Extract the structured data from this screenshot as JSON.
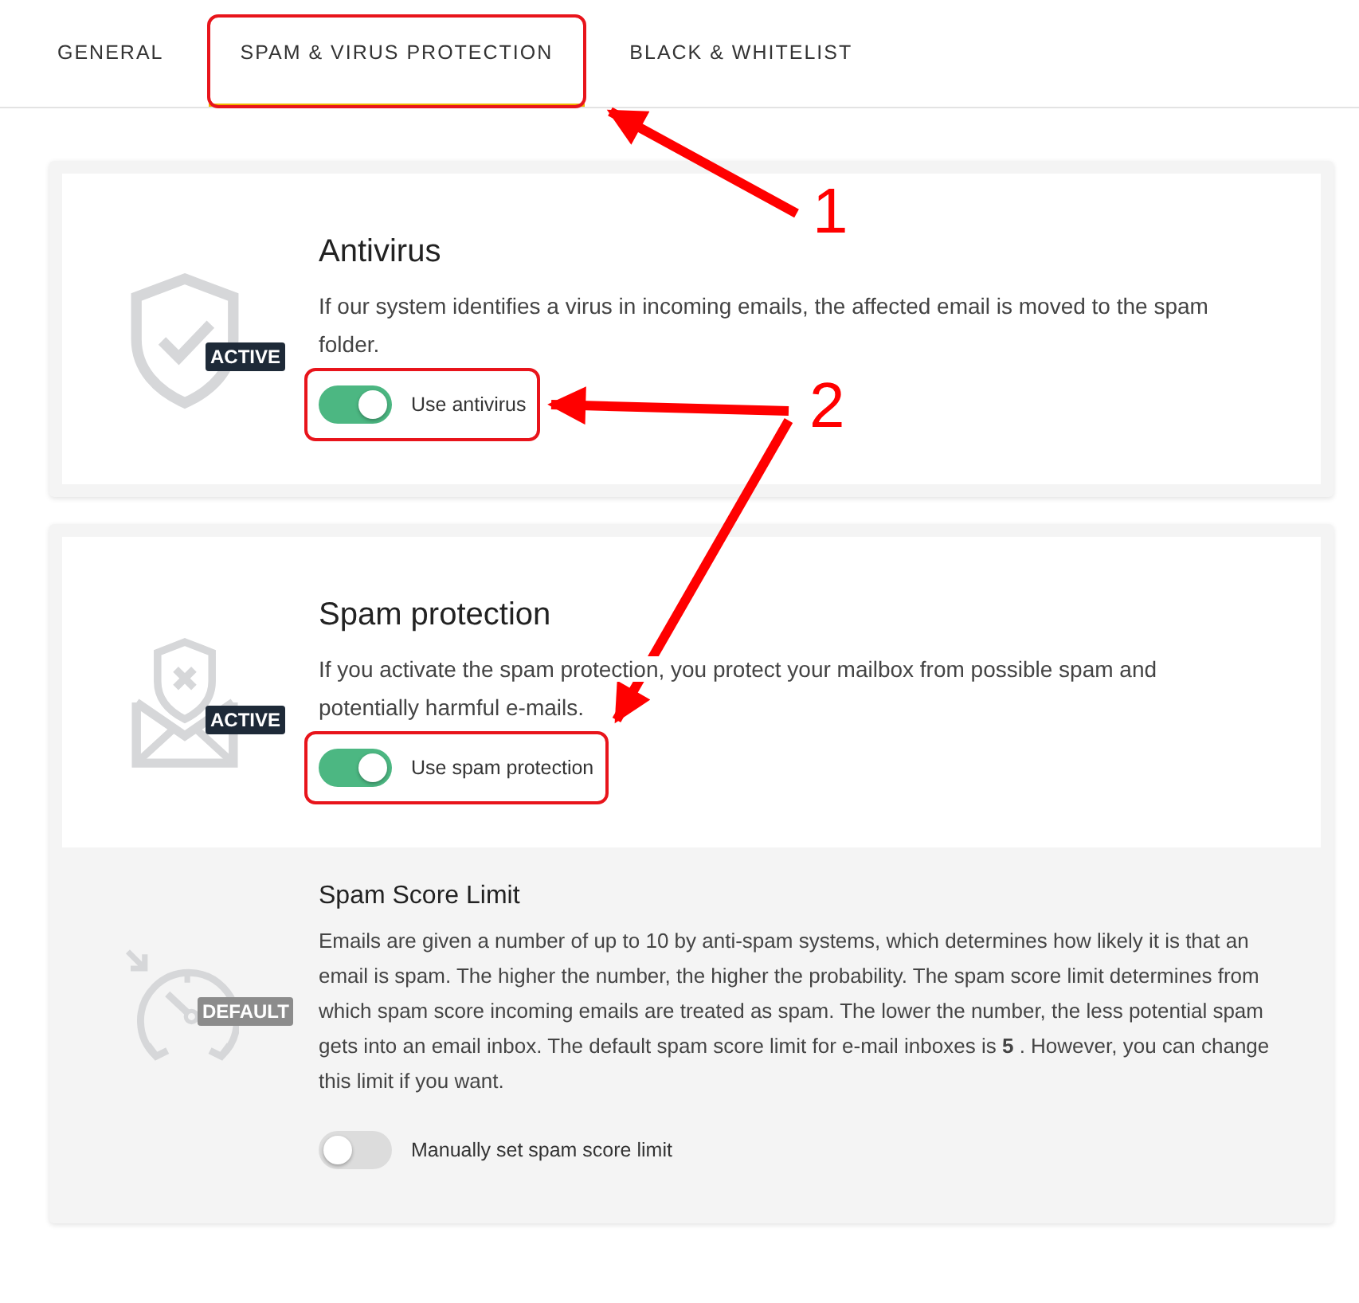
{
  "tabs": [
    {
      "label": "GENERAL",
      "selected": false
    },
    {
      "label": "SPAM & VIRUS PROTECTION",
      "selected": true
    },
    {
      "label": "BLACK & WHITELIST",
      "selected": false
    }
  ],
  "cards": [
    {
      "panels": [
        {
          "kind": "feature",
          "badge": {
            "text": "ACTIVE",
            "kind": "active"
          },
          "title": "Antivirus",
          "description": "If our system identifies a virus in incoming emails, the affected email is moved to the spam folder.",
          "toggle": {
            "label": "Use antivirus",
            "on": true
          }
        }
      ]
    },
    {
      "panels": [
        {
          "kind": "feature",
          "badge": {
            "text": "ACTIVE",
            "kind": "active"
          },
          "title": "Spam protection",
          "description": "If you activate the spam protection, you protect your mailbox from possible spam and potentially harmful e-mails.",
          "toggle": {
            "label": "Use spam protection",
            "on": true
          }
        },
        {
          "kind": "setting",
          "badge": {
            "text": "DEFAULT",
            "kind": "default"
          },
          "title": "Spam Score Limit",
          "description": "Emails are given a number of up to 10 by anti-spam systems, which determines how likely it is that an email is spam. The higher the number, the higher the probability. The spam score limit determines from which spam score incoming emails are treated as spam. The lower the number, the less potential spam gets into an email inbox. The default spam score limit for e-mail inboxes is **5** . However, you can change this limit if you want.",
          "toggle": {
            "label": "Manually set spam score limit",
            "on": false
          }
        }
      ]
    }
  ],
  "annotations": [
    {
      "label": "1"
    },
    {
      "label": "2"
    }
  ]
}
